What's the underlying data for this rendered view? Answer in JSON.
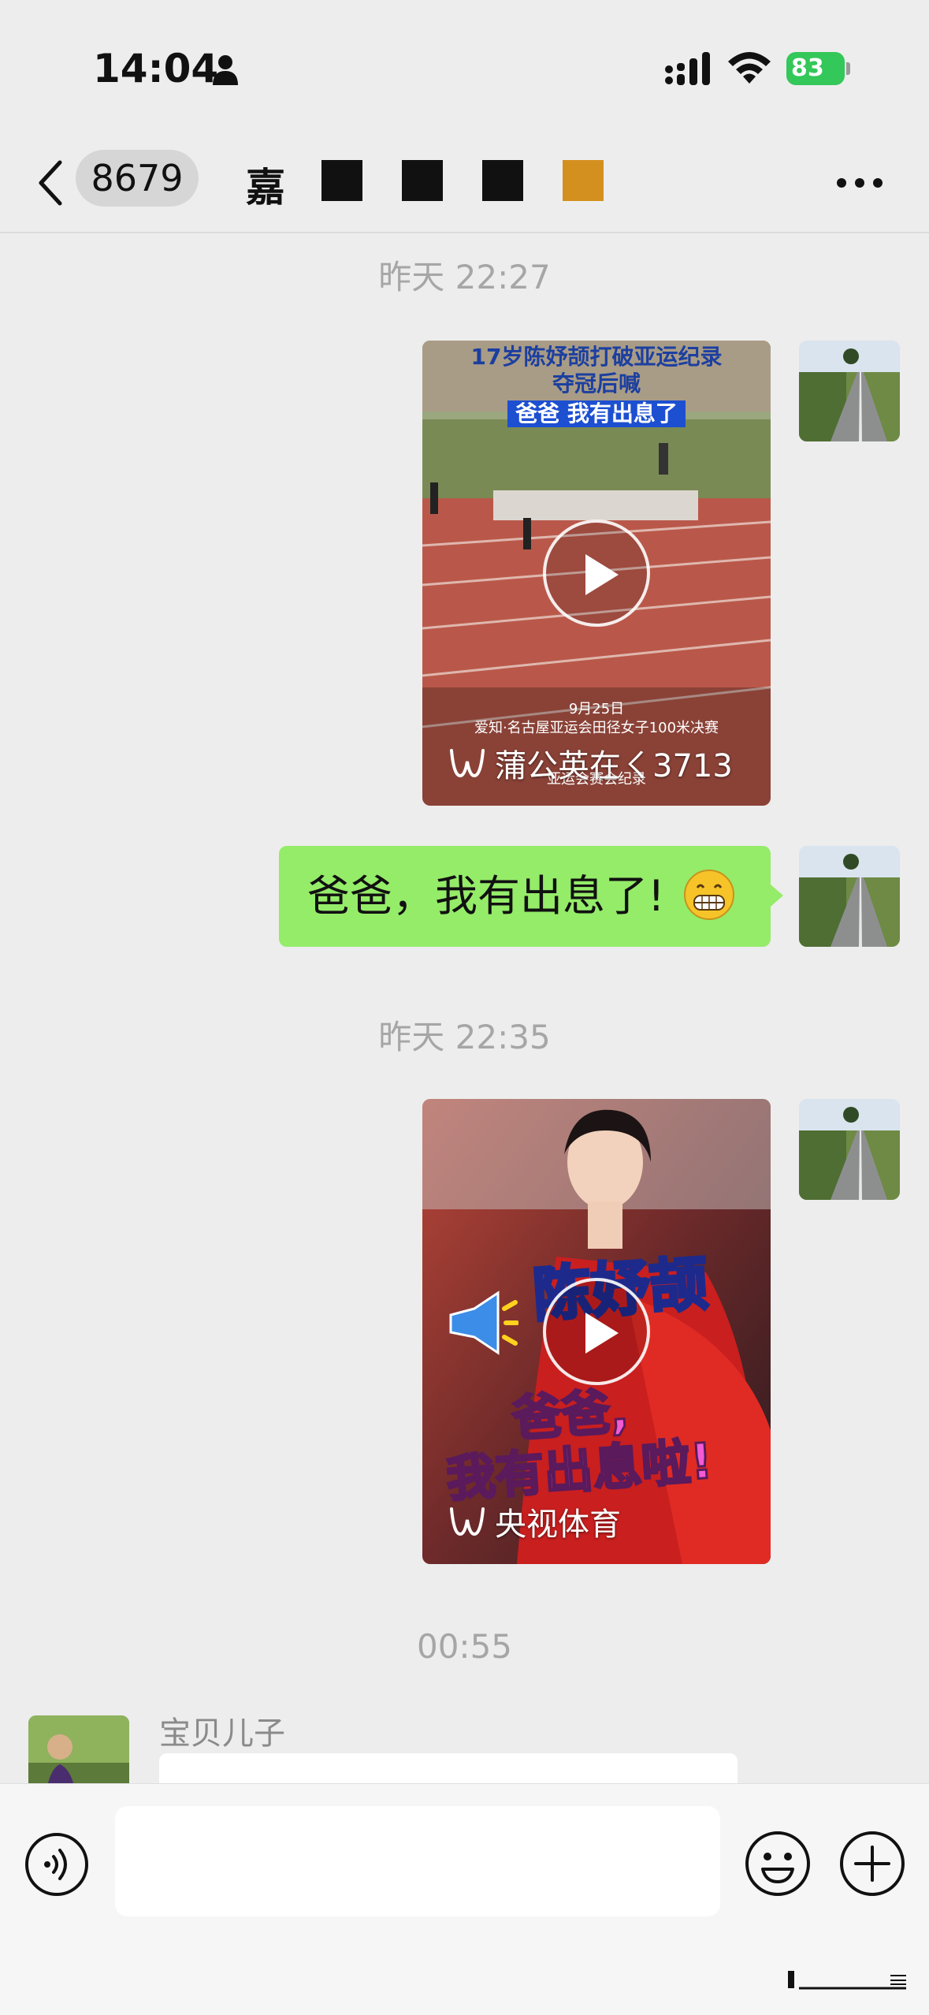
{
  "status_bar": {
    "time": "14:04",
    "battery": "83"
  },
  "header": {
    "unread_count": "8679",
    "title_visible": "嘉",
    "more_label": "more"
  },
  "messages": [
    {
      "type": "time",
      "text": "昨天 22:27"
    },
    {
      "type": "video",
      "side": "right",
      "channel": "蒲公英在ㄑ3713",
      "overlay_title": "17岁陈妤颉打破亚运纪录",
      "overlay_subtitle": "夺冠后喊",
      "overlay_headline": "爸爸 我有出息了",
      "caption_date": "9月25日",
      "caption_line1": "爱知·名古屋亚运会田径女子100米决赛",
      "caption_line2": "亚运会赛会纪录"
    },
    {
      "type": "text",
      "side": "right",
      "text": "爸爸，我有出息了!"
    },
    {
      "type": "time",
      "text": "昨天 22:35"
    },
    {
      "type": "video",
      "side": "right",
      "channel": "央视体育",
      "overlay_name": "陈妤颉",
      "overlay_headline_1": "爸爸,",
      "overlay_headline_2": "我有出息啦!"
    },
    {
      "type": "time",
      "text": "00:55"
    },
    {
      "type": "incoming",
      "side": "left",
      "sender": "宝贝儿子"
    }
  ],
  "input": {
    "value": "",
    "placeholder": ""
  },
  "colors": {
    "outgoing_bubble": "#95ec69",
    "background": "#ededed",
    "battery": "#34c759"
  },
  "icons": [
    "person-icon",
    "signal-icon",
    "wifi-icon",
    "back-icon",
    "more-icon",
    "play-icon",
    "channels-icon",
    "voice-icon",
    "emoji-icon",
    "plus-icon"
  ]
}
